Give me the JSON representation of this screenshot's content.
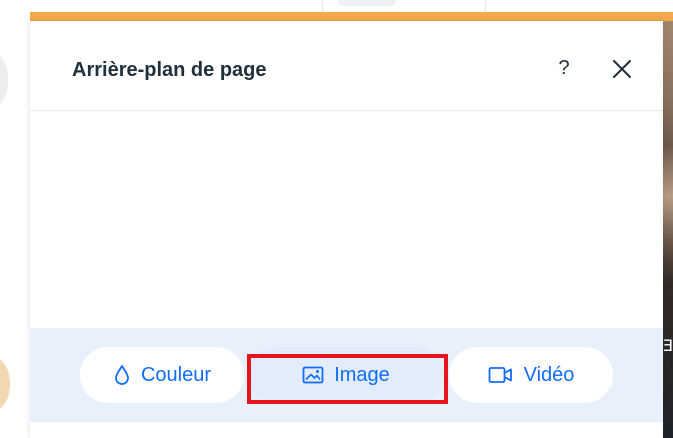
{
  "panel": {
    "title": "Arrière-plan de page",
    "help_label": "?",
    "close_icon": "close-icon",
    "help_icon": "help-icon"
  },
  "background_types": [
    {
      "label": "Couleur",
      "icon": "droplet-icon"
    },
    {
      "label": "Image",
      "icon": "image-icon",
      "selected": true,
      "highlighted": true
    },
    {
      "label": "Vidéo",
      "icon": "video-camera-icon"
    }
  ],
  "colors": {
    "accent": "#116dff",
    "title_text": "#20303c",
    "type_bar_bg": "#e7f0fb",
    "orange_bar": "#f4a84d",
    "highlight_border": "#e8141c"
  }
}
